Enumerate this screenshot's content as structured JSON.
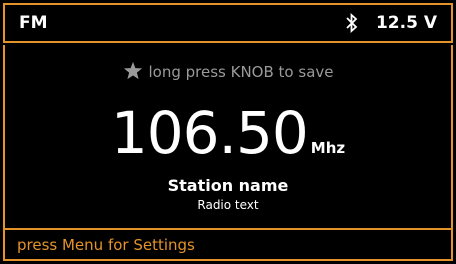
{
  "header": {
    "band": "FM",
    "bluetooth_icon": "bluetooth-icon",
    "voltage": "12.5 V"
  },
  "main": {
    "save_icon": "star-icon",
    "save_hint": "long press KNOB to save",
    "frequency": "106.50",
    "unit": "Mhz",
    "station_name": "Station name",
    "radio_text": "Radio text"
  },
  "footer": {
    "hint": "press Menu for Settings"
  },
  "colors": {
    "accent": "#e3932a",
    "background": "#000000",
    "text": "#ffffff",
    "muted": "#9a9a9a"
  }
}
